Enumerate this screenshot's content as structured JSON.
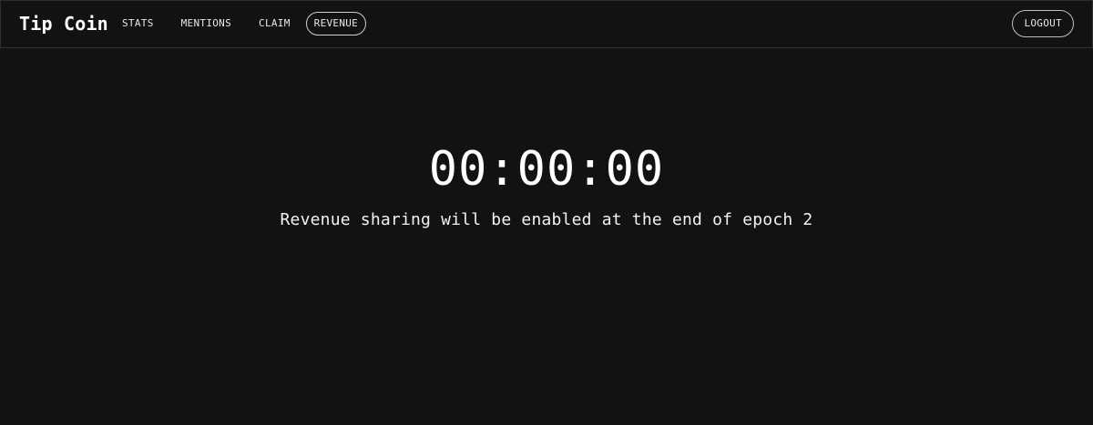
{
  "header": {
    "brand": "Tip Coin",
    "nav": [
      {
        "label": "STATS"
      },
      {
        "label": "MENTIONS"
      },
      {
        "label": "CLAIM"
      },
      {
        "label": "REVENUE",
        "active": true
      }
    ],
    "logout_label": "LOGOUT"
  },
  "main": {
    "countdown": "00:00:00",
    "message": "Revenue sharing will be enabled at the end of epoch 2"
  },
  "colors": {
    "background": "#121212",
    "text": "#ffffff",
    "border": "#2e2e2e"
  }
}
